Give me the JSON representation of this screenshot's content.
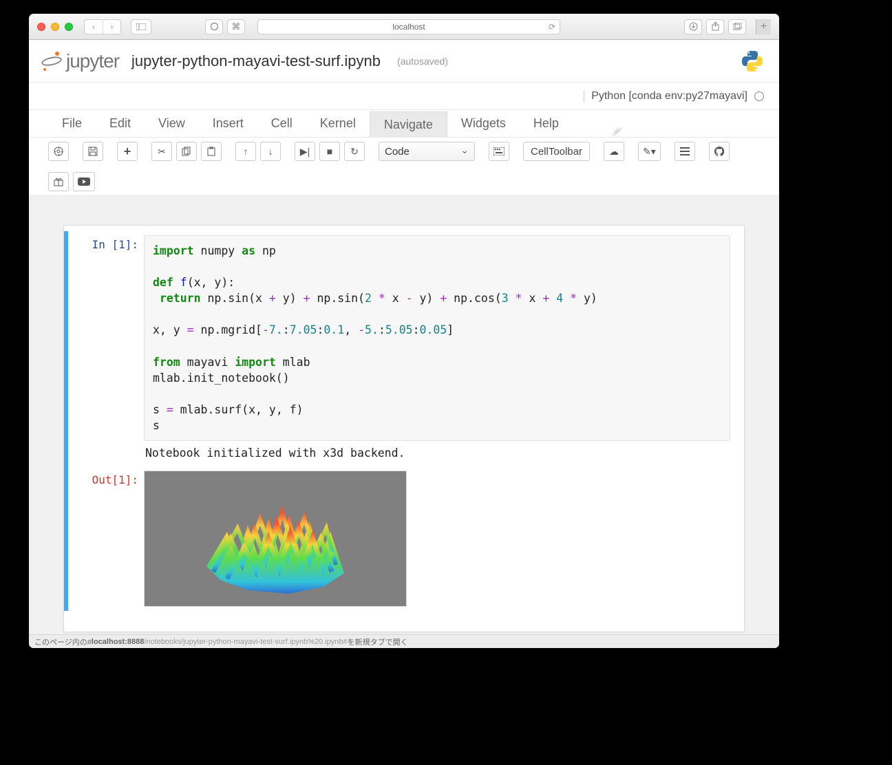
{
  "browser": {
    "url_display": "localhost",
    "status_prefix": "このページ内の#",
    "status_host": "localhost:8888",
    "status_path": "/notebooks/jupyter-python-mayavi-test-surf.ipynb%20.ipynb#",
    "status_suffix": "を新規タブで開く"
  },
  "notebook": {
    "logo_text": "jupyter",
    "title": "jupyter-python-mayavi-test-surf.ipynb",
    "autosaved_label": "(autosaved)",
    "kernel_name": "Python [conda env:py27mayavi]"
  },
  "menu": {
    "items": [
      "File",
      "Edit",
      "View",
      "Insert",
      "Cell",
      "Kernel",
      "Navigate",
      "Widgets",
      "Help"
    ],
    "active_index": 6
  },
  "toolbar": {
    "cell_type_selected": "Code",
    "cell_toolbar_label": "CellToolbar"
  },
  "cells": {
    "in_label": "In [1]:",
    "out_label": "Out[1]:",
    "code_tokens": [
      [
        [
          "kw",
          "import"
        ],
        [
          "txt",
          " numpy "
        ],
        [
          "kw",
          "as"
        ],
        [
          "txt",
          " np"
        ]
      ],
      [
        [
          "txt",
          ""
        ]
      ],
      [
        [
          "kw",
          "def"
        ],
        [
          "txt",
          " "
        ],
        [
          "fn",
          "f"
        ],
        [
          "txt",
          "(x, y):"
        ]
      ],
      [
        [
          "txt",
          " "
        ],
        [
          "kw",
          "return"
        ],
        [
          "txt",
          " np.sin(x "
        ],
        [
          "op",
          "+"
        ],
        [
          "txt",
          " y) "
        ],
        [
          "op",
          "+"
        ],
        [
          "txt",
          " np.sin("
        ],
        [
          "num",
          "2"
        ],
        [
          "txt",
          " "
        ],
        [
          "op",
          "*"
        ],
        [
          "txt",
          " x "
        ],
        [
          "op",
          "-"
        ],
        [
          "txt",
          " y) "
        ],
        [
          "op",
          "+"
        ],
        [
          "txt",
          " np.cos("
        ],
        [
          "num",
          "3"
        ],
        [
          "txt",
          " "
        ],
        [
          "op",
          "*"
        ],
        [
          "txt",
          " x "
        ],
        [
          "op",
          "+"
        ],
        [
          "txt",
          " "
        ],
        [
          "num",
          "4"
        ],
        [
          "txt",
          " "
        ],
        [
          "op",
          "*"
        ],
        [
          "txt",
          " y)"
        ]
      ],
      [
        [
          "txt",
          ""
        ]
      ],
      [
        [
          "txt",
          "x, y "
        ],
        [
          "op",
          "="
        ],
        [
          "txt",
          " np.mgrid["
        ],
        [
          "op",
          "-"
        ],
        [
          "num",
          "7."
        ],
        [
          "txt",
          ":"
        ],
        [
          "num",
          "7.05"
        ],
        [
          "txt",
          ":"
        ],
        [
          "num",
          "0.1"
        ],
        [
          "txt",
          ", "
        ],
        [
          "op",
          "-"
        ],
        [
          "num",
          "5."
        ],
        [
          "txt",
          ":"
        ],
        [
          "num",
          "5.05"
        ],
        [
          "txt",
          ":"
        ],
        [
          "num",
          "0.05"
        ],
        [
          "txt",
          "]"
        ]
      ],
      [
        [
          "txt",
          ""
        ]
      ],
      [
        [
          "kw",
          "from"
        ],
        [
          "txt",
          " mayavi "
        ],
        [
          "kw",
          "import"
        ],
        [
          "txt",
          " mlab"
        ]
      ],
      [
        [
          "txt",
          "mlab.init_notebook()"
        ]
      ],
      [
        [
          "txt",
          ""
        ]
      ],
      [
        [
          "txt",
          "s "
        ],
        [
          "op",
          "="
        ],
        [
          "txt",
          " mlab.surf(x, y, f)"
        ]
      ],
      [
        [
          "txt",
          "s"
        ]
      ]
    ],
    "stdout": "Notebook initialized with x3d backend."
  }
}
